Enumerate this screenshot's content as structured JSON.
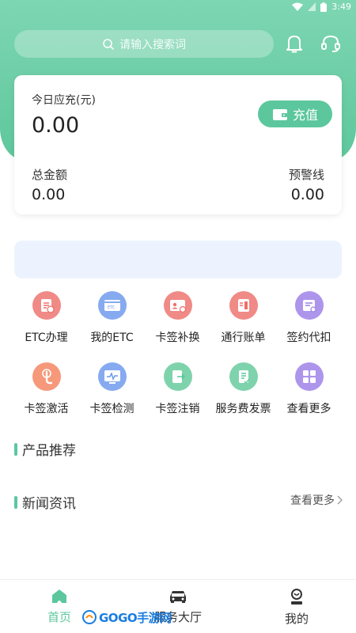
{
  "status_bar": {
    "time": "3:49"
  },
  "search": {
    "placeholder": "请输入搜索词"
  },
  "card": {
    "today_label": "今日应充(元)",
    "today_value": "0.00",
    "recharge_label": "充值",
    "total_label": "总金额",
    "total_value": "0.00",
    "warning_label": "预警线",
    "warning_value": "0.00"
  },
  "grid": {
    "row1": [
      {
        "label": "ETC办理",
        "icon": "etc-apply-icon",
        "color": "#ef6f6a"
      },
      {
        "label": "我的ETC",
        "icon": "etc-card-icon",
        "color": "#6d9be8"
      },
      {
        "label": "卡签补换",
        "icon": "card-replace-icon",
        "color": "#ef6f6a"
      },
      {
        "label": "通行账单",
        "icon": "bill-icon",
        "color": "#ef6f6a"
      },
      {
        "label": "签约代扣",
        "icon": "contract-icon",
        "color": "#9a7de6"
      }
    ],
    "row2": [
      {
        "label": "卡签激活",
        "icon": "activate-icon",
        "color": "#f5845b"
      },
      {
        "label": "卡签检测",
        "icon": "detect-icon",
        "color": "#6d9be8"
      },
      {
        "label": "卡签注销",
        "icon": "cancel-icon",
        "color": "#5cc79d"
      },
      {
        "label": "服务费发票",
        "icon": "invoice-icon",
        "color": "#5cc79d"
      },
      {
        "label": "查看更多",
        "icon": "more-grid-icon",
        "color": "#9a7de6"
      }
    ]
  },
  "sections": {
    "products": "产品推荐",
    "news": "新闻资讯",
    "see_more": "查看更多"
  },
  "nav": {
    "home": "首页",
    "service": "服务大厅",
    "mine": "我的"
  },
  "watermark": {
    "text": "GOGO手游网"
  },
  "colors": {
    "accent": "#5cc79d",
    "banner": "#edf3fe"
  }
}
